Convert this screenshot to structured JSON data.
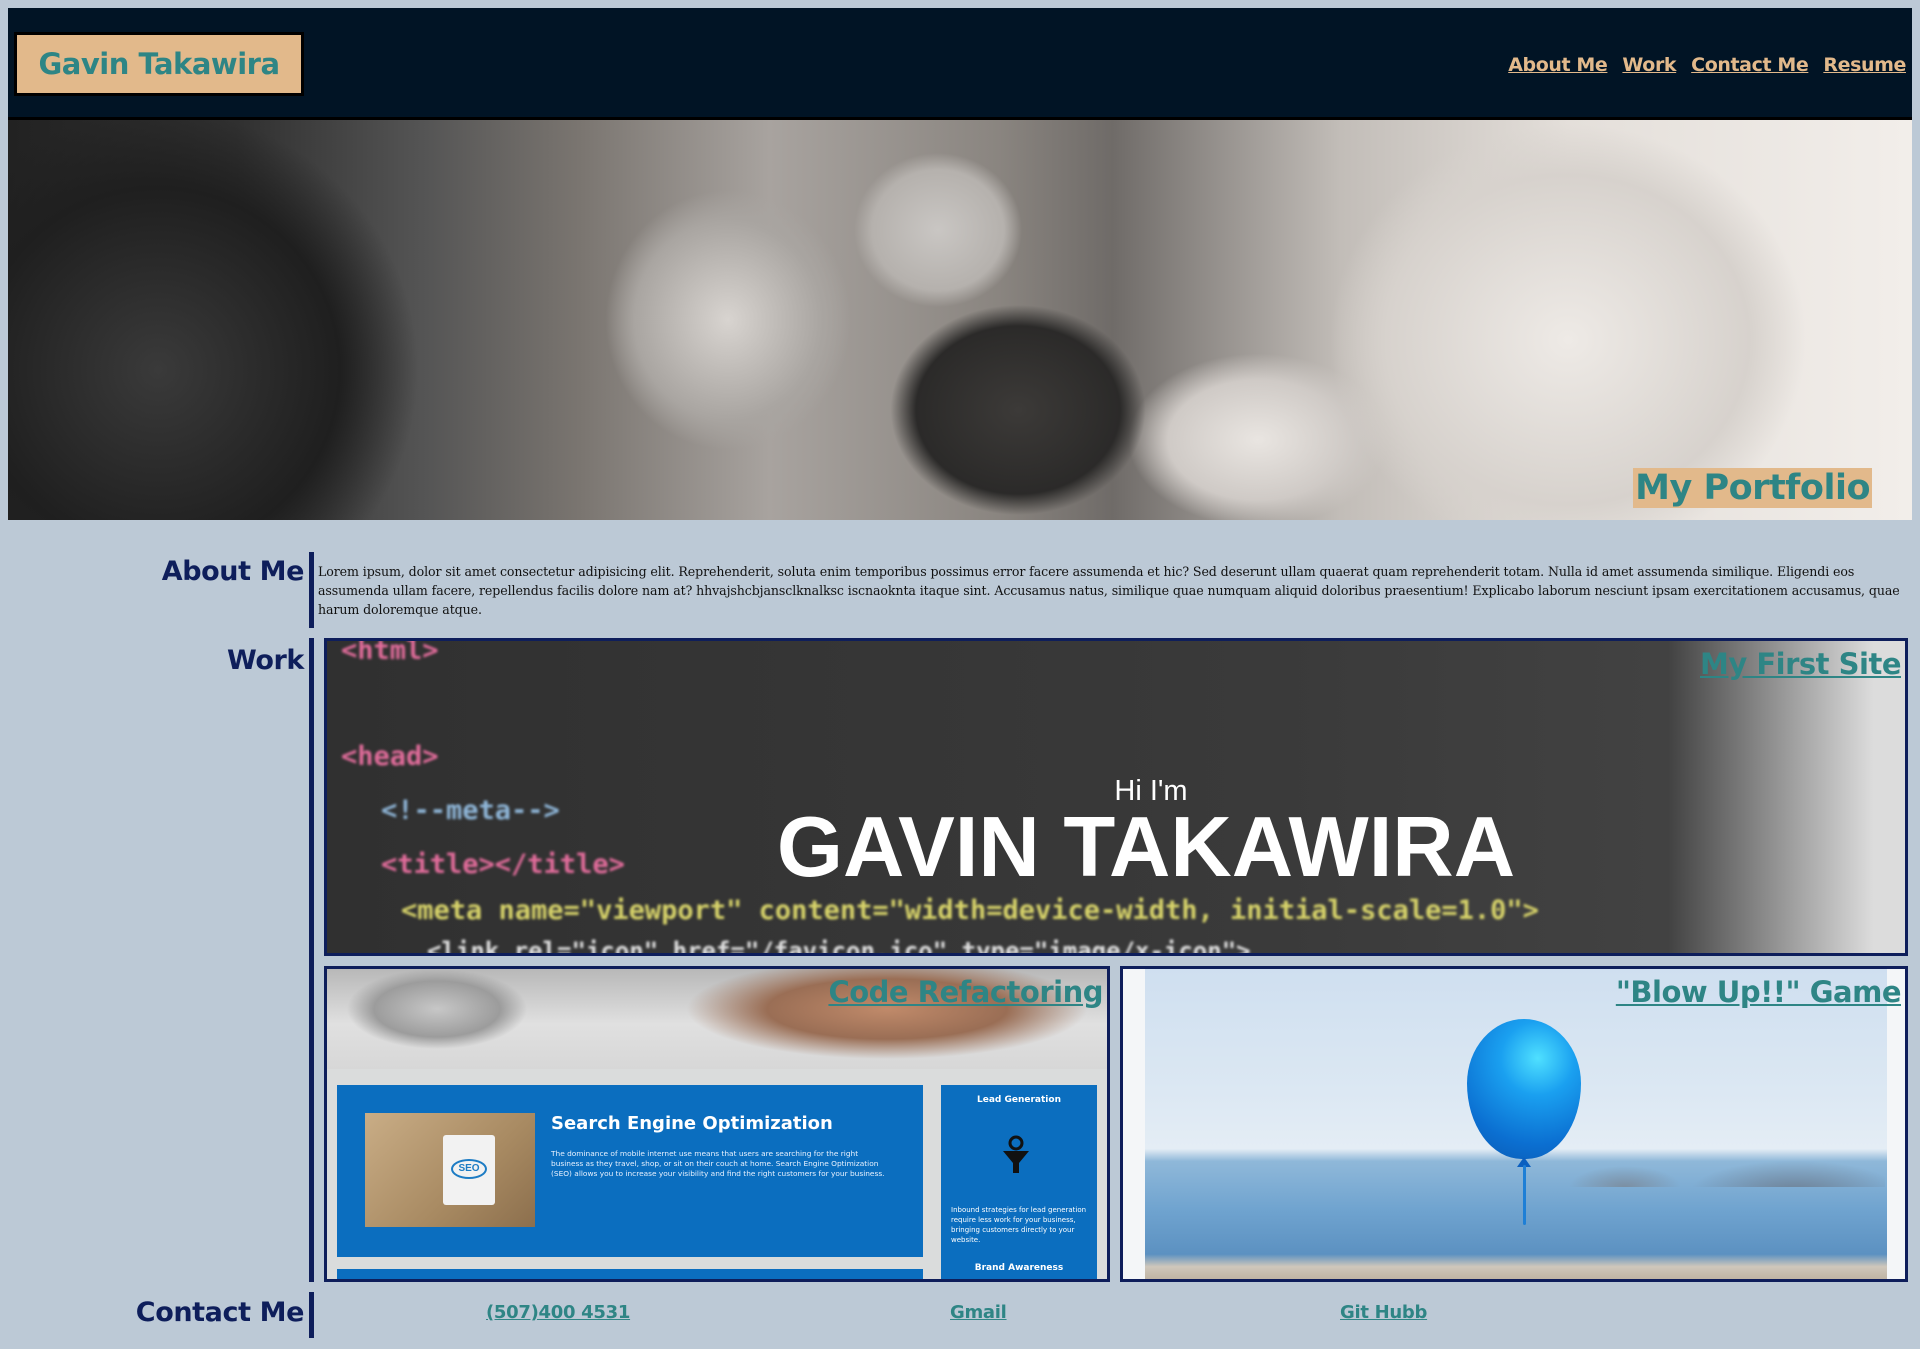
{
  "header": {
    "brand": "Gavin Takawira",
    "nav": [
      "About Me",
      "Work",
      "Contact Me",
      "Resume"
    ]
  },
  "hero": {
    "title": "My Portfolio"
  },
  "about": {
    "heading": "About Me",
    "text": "Lorem ipsum, dolor sit amet consectetur adipisicing elit. Reprehenderit, soluta enim temporibus possimus error facere assumenda et hic? Sed deserunt ullam quaerat quam reprehenderit totam. Nulla id amet assumenda similique. Eligendi eos assumenda ullam facere, repellendus facilis dolore nam at? hhvajshcbjansclknalksc iscnaoknta itaque sint. Accusamus natus, similique quae numquam aliquid doloribus praesentium! Explicabo laborum nesciunt ipsam exercitationem accusamus, quae harum doloremque atque."
  },
  "work": {
    "heading": "Work",
    "projects": [
      {
        "title": "My First Site",
        "preview": {
          "greeting": "Hi I'm",
          "name": "GAVIN TAKAWIRA",
          "code_lines": [
            "<html>",
            "<head>",
            "<!--meta-->",
            "<title></title>",
            "<meta name=\"viewport\" content=\"width=device-width, initial-scale=1.0\">",
            "<link rel=\"icon\" href=\"/favicon.ico\" type=\"image/x-icon\">"
          ]
        }
      },
      {
        "title": "Code Refactoring",
        "preview": {
          "seo_heading": "Search Engine Optimization",
          "seo_text": "The dominance of mobile internet use means that users are searching for the right business as they travel, shop, or sit on their couch at home. Search Engine Optimization (SEO) allows you to increase your visibility and find the right customers for your business.",
          "seo_badge": "SEO",
          "lead_heading": "Lead Generation",
          "lead_text": "Inbound strategies for lead generation require less work for your business, bringing customers directly to your website.",
          "brand_heading": "Brand Awareness"
        }
      },
      {
        "title": "\"Blow Up!!\" Game"
      }
    ]
  },
  "contact": {
    "heading": "Contact Me",
    "links": [
      "(507)400 4531",
      "Gmail",
      "Git Hubb"
    ]
  }
}
